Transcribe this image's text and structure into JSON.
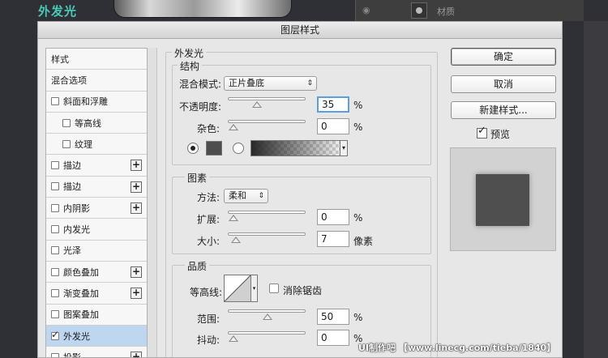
{
  "background": {
    "app_title": "外发光",
    "layer_name": "材质"
  },
  "dialog": {
    "title": "图层样式",
    "styles_list": [
      {
        "label": "样式",
        "checkbox": false,
        "checked": false,
        "plus": false,
        "indent": false,
        "selected": false
      },
      {
        "label": "混合选项",
        "checkbox": false,
        "checked": false,
        "plus": false,
        "indent": false,
        "selected": false
      },
      {
        "label": "斜面和浮雕",
        "checkbox": true,
        "checked": false,
        "plus": false,
        "indent": false,
        "selected": false
      },
      {
        "label": "等高线",
        "checkbox": true,
        "checked": false,
        "plus": false,
        "indent": true,
        "selected": false
      },
      {
        "label": "纹理",
        "checkbox": true,
        "checked": false,
        "plus": false,
        "indent": true,
        "selected": false
      },
      {
        "label": "描边",
        "checkbox": true,
        "checked": false,
        "plus": true,
        "indent": false,
        "selected": false
      },
      {
        "label": "描边",
        "checkbox": true,
        "checked": false,
        "plus": true,
        "indent": false,
        "selected": false
      },
      {
        "label": "内阴影",
        "checkbox": true,
        "checked": false,
        "plus": true,
        "indent": false,
        "selected": false
      },
      {
        "label": "内发光",
        "checkbox": true,
        "checked": false,
        "plus": false,
        "indent": false,
        "selected": false
      },
      {
        "label": "光泽",
        "checkbox": true,
        "checked": false,
        "plus": false,
        "indent": false,
        "selected": false
      },
      {
        "label": "颜色叠加",
        "checkbox": true,
        "checked": false,
        "plus": true,
        "indent": false,
        "selected": false
      },
      {
        "label": "渐变叠加",
        "checkbox": true,
        "checked": false,
        "plus": true,
        "indent": false,
        "selected": false
      },
      {
        "label": "图案叠加",
        "checkbox": true,
        "checked": false,
        "plus": false,
        "indent": false,
        "selected": false
      },
      {
        "label": "外发光",
        "checkbox": true,
        "checked": true,
        "plus": false,
        "indent": false,
        "selected": true
      },
      {
        "label": "投影",
        "checkbox": true,
        "checked": false,
        "plus": true,
        "indent": false,
        "selected": false
      }
    ],
    "outer_glow": {
      "section_title": "外发光",
      "structure": {
        "title": "结构",
        "blend_mode_label": "混合模式:",
        "blend_mode_value": "正片叠底",
        "opacity_label": "不透明度:",
        "opacity_value": "35",
        "opacity_fraction": 0.35,
        "noise_label": "杂色:",
        "noise_value": "0",
        "noise_fraction": 0,
        "percent": "%",
        "glow_color": "#4d4d4d"
      },
      "elements": {
        "title": "图素",
        "technique_label": "方法:",
        "technique_value": "柔和",
        "spread_label": "扩展:",
        "spread_value": "0",
        "spread_fraction": 0,
        "size_label": "大小:",
        "size_value": "7",
        "size_fraction": 0.03,
        "percent": "%",
        "px_unit": "像素"
      },
      "quality": {
        "title": "品质",
        "contour_label": "等高线:",
        "antialias_label": "消除锯齿",
        "range_label": "范围:",
        "range_value": "50",
        "range_fraction": 0.5,
        "jitter_label": "抖动:",
        "jitter_value": "0",
        "jitter_fraction": 0,
        "percent": "%"
      }
    },
    "buttons": {
      "ok": "确定",
      "cancel": "取消",
      "new_style": "新建样式...",
      "preview_label": "预览"
    },
    "preview_color": "#4f4f4f"
  },
  "watermark": "UI制作吧 【www.linecg.com/tieba/1840】"
}
